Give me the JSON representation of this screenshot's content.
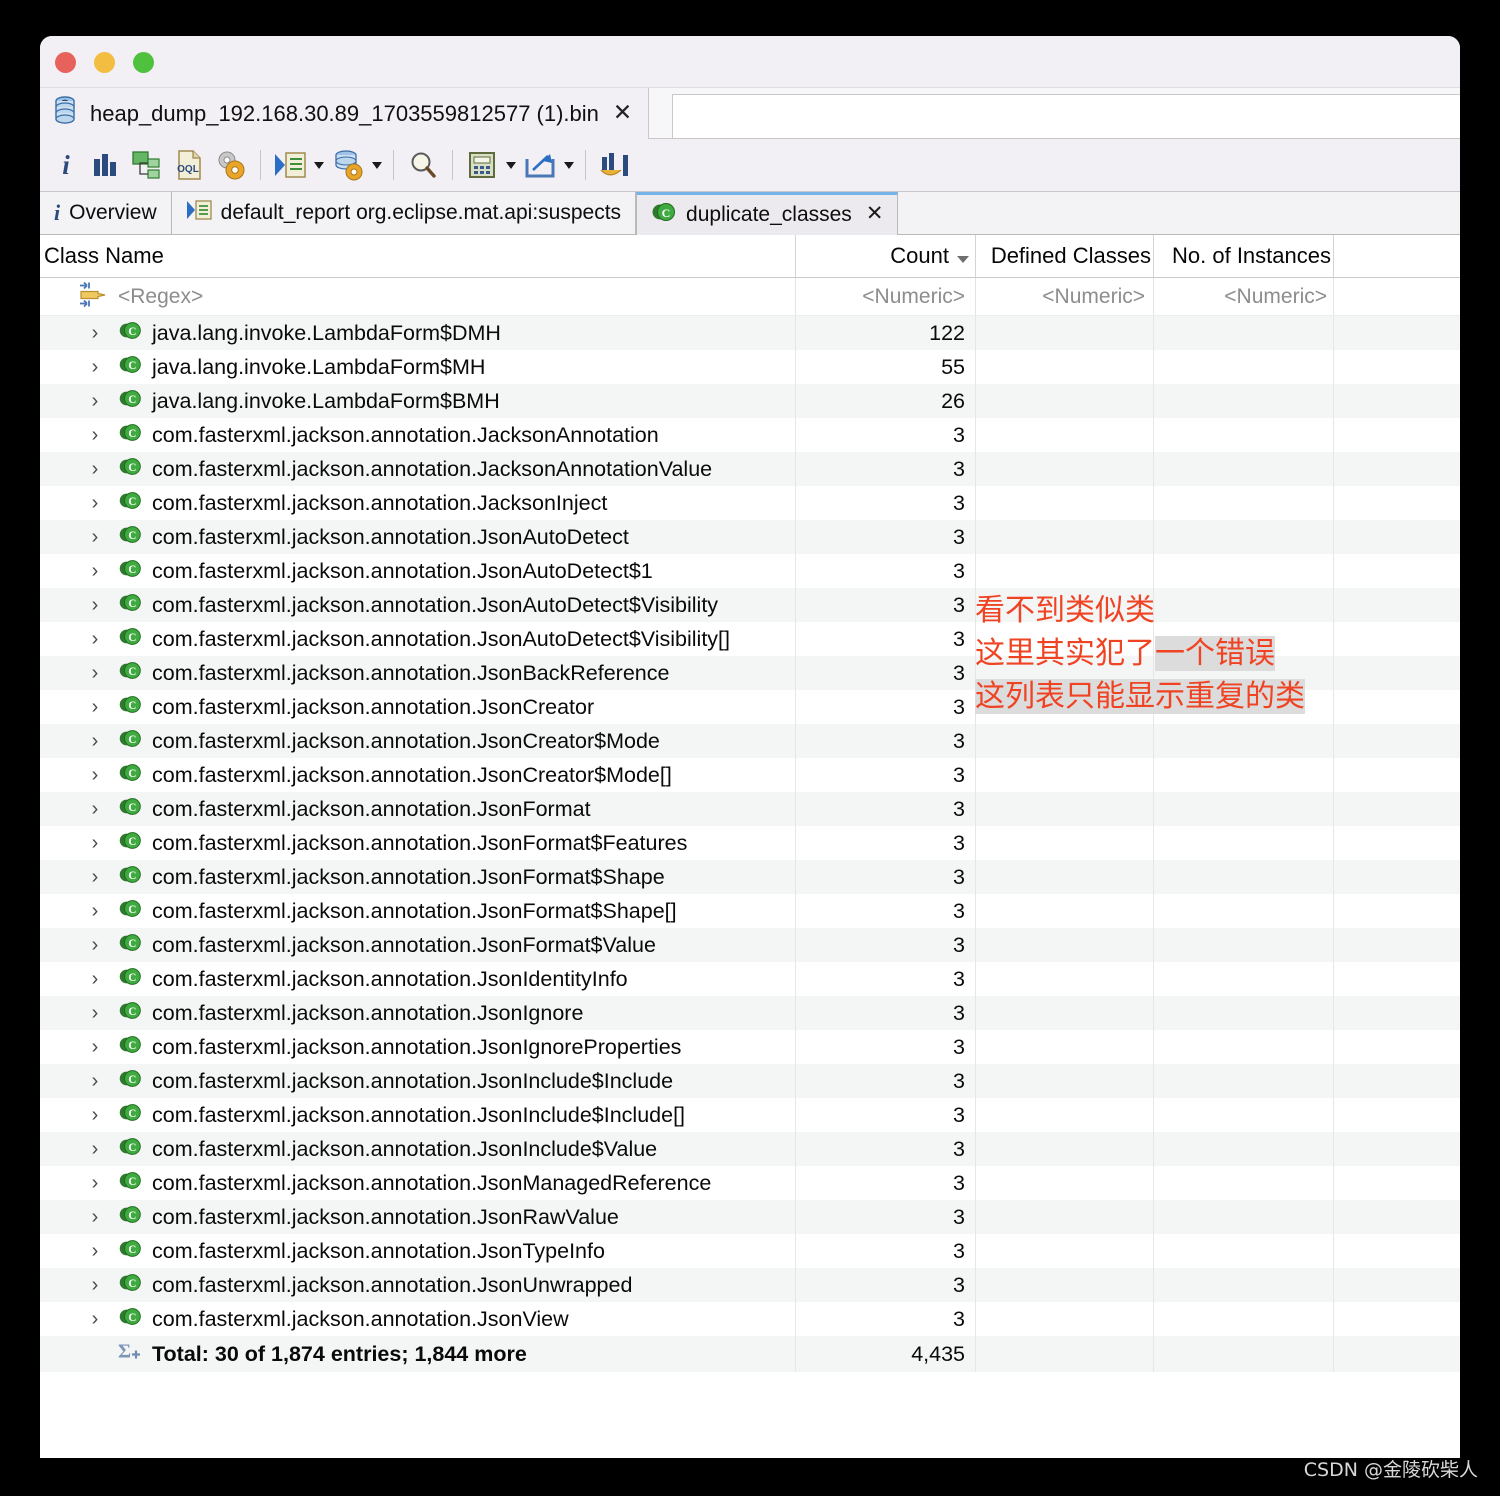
{
  "window": {
    "traffic_lights": [
      "close",
      "minimize",
      "maximize"
    ],
    "colors": {
      "close": "#e8625d",
      "minimize": "#f2bd41",
      "maximize": "#4fc13f",
      "accent_tab": "#73b3e8",
      "annotation_red": "#ef4323",
      "class_icon_green": "#3faa3f"
    }
  },
  "file_tab": {
    "icon": "heap-dump-icon",
    "title": "heap_dump_192.168.30.89_1703559812577 (1).bin",
    "close_label": "✕"
  },
  "toolbar": {
    "buttons": [
      {
        "name": "info-icon",
        "label": "i",
        "has_arrow": false
      },
      {
        "name": "histogram-icon",
        "label": "",
        "has_arrow": false
      },
      {
        "name": "dominator-tree-icon",
        "label": "",
        "has_arrow": false
      },
      {
        "name": "oql-icon",
        "label": "OQL",
        "has_arrow": false
      },
      {
        "name": "inspect-gear-icon",
        "label": "",
        "has_arrow": false
      },
      {
        "name": "run-report-icon",
        "label": "",
        "has_arrow": true
      },
      {
        "name": "heap-settings-icon",
        "label": "",
        "has_arrow": true
      },
      {
        "name": "search-icon",
        "label": "",
        "has_arrow": false
      },
      {
        "name": "calculator-icon",
        "label": "",
        "has_arrow": true
      },
      {
        "name": "export-icon",
        "label": "",
        "has_arrow": true
      },
      {
        "name": "compare-histogram-icon",
        "label": "",
        "has_arrow": false
      }
    ]
  },
  "view_tabs": [
    {
      "label": "Overview",
      "icon": "info-icon",
      "active": false,
      "closable": false
    },
    {
      "label": "default_report org.eclipse.mat.api:suspects",
      "icon": "report-icon",
      "active": false,
      "closable": false
    },
    {
      "label": "duplicate_classes",
      "icon": "class-icon",
      "active": true,
      "closable": true,
      "close_label": "✕"
    }
  ],
  "table": {
    "columns": [
      {
        "key": "class_name",
        "label": "Class Name",
        "sorted": false
      },
      {
        "key": "count",
        "label": "Count",
        "sorted": true,
        "sort_dir": "desc"
      },
      {
        "key": "defined_classes",
        "label": "Defined Classes",
        "sorted": false
      },
      {
        "key": "no_of_instances",
        "label": "No. of Instances",
        "sorted": false
      }
    ],
    "filter_row": {
      "class_name": "<Regex>",
      "count": "<Numeric>",
      "defined_classes": "<Numeric>",
      "no_of_instances": "<Numeric>",
      "icon": "regex-filter-icon"
    },
    "expander_glyph": "›",
    "row_icon": "class-icon",
    "rows": [
      {
        "class_name": "java.lang.invoke.LambdaForm$DMH",
        "count": "122",
        "defined_classes": "",
        "no_of_instances": ""
      },
      {
        "class_name": "java.lang.invoke.LambdaForm$MH",
        "count": "55",
        "defined_classes": "",
        "no_of_instances": ""
      },
      {
        "class_name": "java.lang.invoke.LambdaForm$BMH",
        "count": "26",
        "defined_classes": "",
        "no_of_instances": ""
      },
      {
        "class_name": "com.fasterxml.jackson.annotation.JacksonAnnotation",
        "count": "3",
        "defined_classes": "",
        "no_of_instances": ""
      },
      {
        "class_name": "com.fasterxml.jackson.annotation.JacksonAnnotationValue",
        "count": "3",
        "defined_classes": "",
        "no_of_instances": ""
      },
      {
        "class_name": "com.fasterxml.jackson.annotation.JacksonInject",
        "count": "3",
        "defined_classes": "",
        "no_of_instances": ""
      },
      {
        "class_name": "com.fasterxml.jackson.annotation.JsonAutoDetect",
        "count": "3",
        "defined_classes": "",
        "no_of_instances": ""
      },
      {
        "class_name": "com.fasterxml.jackson.annotation.JsonAutoDetect$1",
        "count": "3",
        "defined_classes": "",
        "no_of_instances": ""
      },
      {
        "class_name": "com.fasterxml.jackson.annotation.JsonAutoDetect$Visibility",
        "count": "3",
        "defined_classes": "",
        "no_of_instances": ""
      },
      {
        "class_name": "com.fasterxml.jackson.annotation.JsonAutoDetect$Visibility[]",
        "count": "3",
        "defined_classes": "",
        "no_of_instances": ""
      },
      {
        "class_name": "com.fasterxml.jackson.annotation.JsonBackReference",
        "count": "3",
        "defined_classes": "",
        "no_of_instances": ""
      },
      {
        "class_name": "com.fasterxml.jackson.annotation.JsonCreator",
        "count": "3",
        "defined_classes": "",
        "no_of_instances": ""
      },
      {
        "class_name": "com.fasterxml.jackson.annotation.JsonCreator$Mode",
        "count": "3",
        "defined_classes": "",
        "no_of_instances": ""
      },
      {
        "class_name": "com.fasterxml.jackson.annotation.JsonCreator$Mode[]",
        "count": "3",
        "defined_classes": "",
        "no_of_instances": ""
      },
      {
        "class_name": "com.fasterxml.jackson.annotation.JsonFormat",
        "count": "3",
        "defined_classes": "",
        "no_of_instances": ""
      },
      {
        "class_name": "com.fasterxml.jackson.annotation.JsonFormat$Features",
        "count": "3",
        "defined_classes": "",
        "no_of_instances": ""
      },
      {
        "class_name": "com.fasterxml.jackson.annotation.JsonFormat$Shape",
        "count": "3",
        "defined_classes": "",
        "no_of_instances": ""
      },
      {
        "class_name": "com.fasterxml.jackson.annotation.JsonFormat$Shape[]",
        "count": "3",
        "defined_classes": "",
        "no_of_instances": ""
      },
      {
        "class_name": "com.fasterxml.jackson.annotation.JsonFormat$Value",
        "count": "3",
        "defined_classes": "",
        "no_of_instances": ""
      },
      {
        "class_name": "com.fasterxml.jackson.annotation.JsonIdentityInfo",
        "count": "3",
        "defined_classes": "",
        "no_of_instances": ""
      },
      {
        "class_name": "com.fasterxml.jackson.annotation.JsonIgnore",
        "count": "3",
        "defined_classes": "",
        "no_of_instances": ""
      },
      {
        "class_name": "com.fasterxml.jackson.annotation.JsonIgnoreProperties",
        "count": "3",
        "defined_classes": "",
        "no_of_instances": ""
      },
      {
        "class_name": "com.fasterxml.jackson.annotation.JsonInclude$Include",
        "count": "3",
        "defined_classes": "",
        "no_of_instances": ""
      },
      {
        "class_name": "com.fasterxml.jackson.annotation.JsonInclude$Include[]",
        "count": "3",
        "defined_classes": "",
        "no_of_instances": ""
      },
      {
        "class_name": "com.fasterxml.jackson.annotation.JsonInclude$Value",
        "count": "3",
        "defined_classes": "",
        "no_of_instances": ""
      },
      {
        "class_name": "com.fasterxml.jackson.annotation.JsonManagedReference",
        "count": "3",
        "defined_classes": "",
        "no_of_instances": ""
      },
      {
        "class_name": "com.fasterxml.jackson.annotation.JsonRawValue",
        "count": "3",
        "defined_classes": "",
        "no_of_instances": ""
      },
      {
        "class_name": "com.fasterxml.jackson.annotation.JsonTypeInfo",
        "count": "3",
        "defined_classes": "",
        "no_of_instances": ""
      },
      {
        "class_name": "com.fasterxml.jackson.annotation.JsonUnwrapped",
        "count": "3",
        "defined_classes": "",
        "no_of_instances": ""
      },
      {
        "class_name": "com.fasterxml.jackson.annotation.JsonView",
        "count": "3",
        "defined_classes": "",
        "no_of_instances": ""
      }
    ],
    "total_row": {
      "icon": "sum-icon",
      "label": "Total: 30 of 1,874 entries; 1,844 more",
      "count": "4,435",
      "defined_classes": "",
      "no_of_instances": ""
    }
  },
  "annotation": {
    "line1": "看不到类似类",
    "line2_plain": "这里其实犯了",
    "line2_highlight": "一个错误",
    "line3_plain": "这列表只能显示",
    "line3_highlight": "重复的类"
  },
  "watermark": "CSDN @金陵砍柴人"
}
